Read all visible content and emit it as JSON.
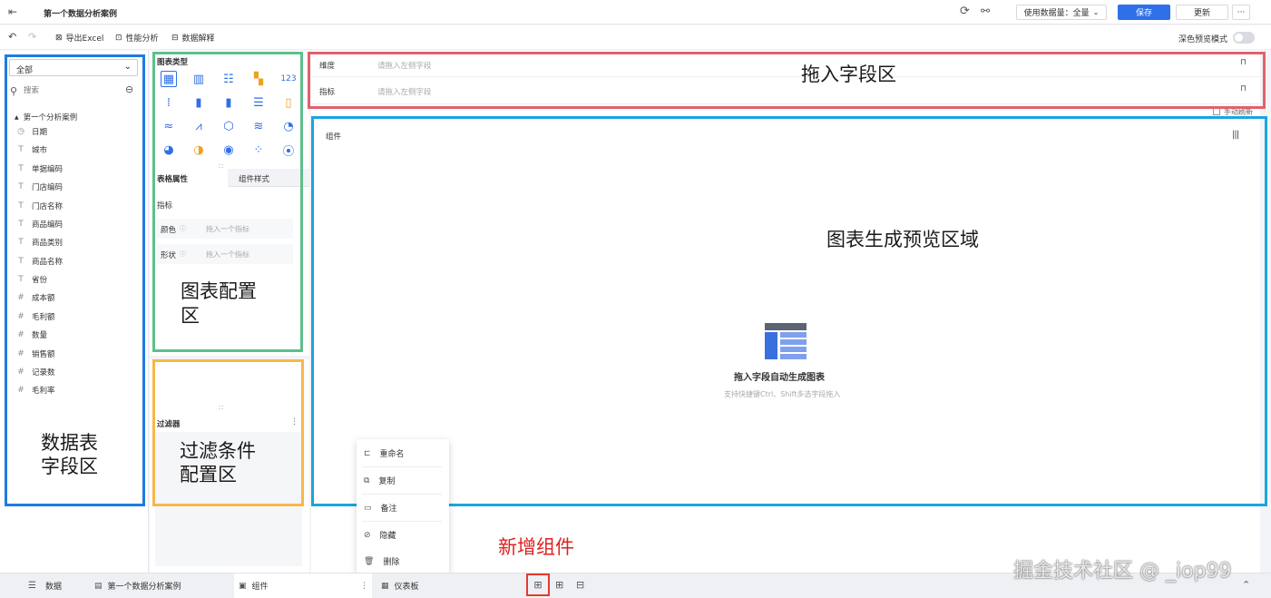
{
  "topbar": {
    "title": "第一个数据分析案例",
    "data_volume_label": "使用数据量：全量",
    "save_label": "保存",
    "update_label": "更新",
    "more_label": "···"
  },
  "toolbar": {
    "export_label": "导出Excel",
    "perf_label": "性能分析",
    "explain_label": "数据解释",
    "dark_preview_label": "深色预览模式"
  },
  "left_panel": {
    "select_value": "全部",
    "search_placeholder": "搜索",
    "group_name": "第一个分析案例",
    "fields": [
      {
        "icon": "◷",
        "label": "日期"
      },
      {
        "icon": "T",
        "label": "城市"
      },
      {
        "icon": "T",
        "label": "单据编码"
      },
      {
        "icon": "T",
        "label": "门店编码"
      },
      {
        "icon": "T",
        "label": "门店名称"
      },
      {
        "icon": "T",
        "label": "商品编码"
      },
      {
        "icon": "T",
        "label": "商品类别"
      },
      {
        "icon": "T",
        "label": "商品名称"
      },
      {
        "icon": "T",
        "label": "省份"
      },
      {
        "icon": "#",
        "label": "成本额"
      },
      {
        "icon": "#",
        "label": "毛利额"
      },
      {
        "icon": "#",
        "label": "数量"
      },
      {
        "icon": "#",
        "label": "销售额"
      },
      {
        "icon": "#",
        "label": "记录数"
      },
      {
        "icon": "#",
        "label": "毛利率"
      }
    ]
  },
  "mid_panel": {
    "chart_type_title": "图表类型",
    "tab_attr": "表格属性",
    "tab_style": "组件样式",
    "metric_label": "指标",
    "color_label": "颜色",
    "shape_label": "形状",
    "drop_metric_placeholder": "拖入一个指标",
    "filter_label": "过滤器"
  },
  "main": {
    "dimension_label": "维度",
    "indicator_label": "指标",
    "drop_placeholder": "请拖入左侧字段",
    "manual_label": "手动刷新",
    "component_label": "组件",
    "empty_title": "拖入字段自动生成图表",
    "empty_sub": "支持快捷键Ctrl、Shift多选字段拖入"
  },
  "annotations": {
    "drop_zone": "拖入字段区",
    "preview_zone": "图表生成预览区域",
    "config_zone_1": "图表配置",
    "config_zone_2": "区",
    "data_zone_1": "数据表",
    "data_zone_2": "字段区",
    "filter_zone_1": "过滤条件",
    "filter_zone_2": "配置区",
    "new_component": "新增组件",
    "colors": {
      "red": "#e0616b",
      "blue": "#1aa5e0",
      "green": "#5cc08a",
      "orange": "#f5b84a",
      "deepblue": "#1e7be0"
    }
  },
  "context_menu": {
    "items": [
      "重命名",
      "复制",
      "备注",
      "隐藏",
      "删除"
    ]
  },
  "bottombar": {
    "data_tab": "数据",
    "analysis_tab": "第一个数据分析案例",
    "component_tab": "组件",
    "dashboard_tab": "仪表板"
  },
  "watermark": "掘金技术社区 @ _iop99"
}
